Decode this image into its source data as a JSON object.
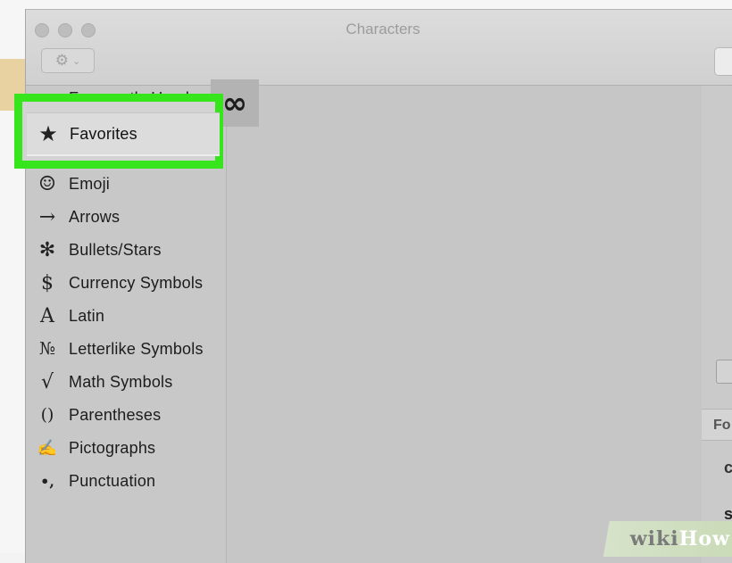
{
  "window": {
    "title": "Characters"
  },
  "toolbar": {
    "gear_icon": "gear-icon",
    "chevron_icon": "chevron-down-icon"
  },
  "sidebar": {
    "items": [
      {
        "label": "Frequently Used",
        "icon": "clock-icon"
      },
      {
        "label": "Favorites",
        "icon": "star-icon",
        "glyph": "★"
      },
      {
        "label": "Emoji",
        "icon": "emoji-icon",
        "glyph": "☺"
      },
      {
        "label": "Arrows",
        "icon": "arrow-icon",
        "glyph": "→"
      },
      {
        "label": "Bullets/Stars",
        "icon": "bullet-star-icon",
        "glyph": "✻"
      },
      {
        "label": "Currency Symbols",
        "icon": "dollar-icon",
        "glyph": "$"
      },
      {
        "label": "Latin",
        "icon": "latin-a-icon",
        "glyph": "A"
      },
      {
        "label": "Letterlike Symbols",
        "icon": "numero-icon",
        "glyph": "№"
      },
      {
        "label": "Math Symbols",
        "icon": "square-root-icon",
        "glyph": "√"
      },
      {
        "label": "Parentheses",
        "icon": "parentheses-icon",
        "glyph": "()"
      },
      {
        "label": "Pictographs",
        "icon": "writing-hand-icon",
        "glyph": "✍"
      },
      {
        "label": "Punctuation",
        "icon": "punctuation-icon",
        "glyph": "•,"
      }
    ]
  },
  "main": {
    "favorite_characters": [
      "∞"
    ]
  },
  "right_panel": {
    "header_fragment": "Fo"
  },
  "watermark": {
    "part1": "wiki",
    "part2": "How"
  },
  "colors": {
    "highlight": "#37e51d",
    "selected_row": "#dcdcdc",
    "sidebar_bg": "#c8c8c8"
  }
}
